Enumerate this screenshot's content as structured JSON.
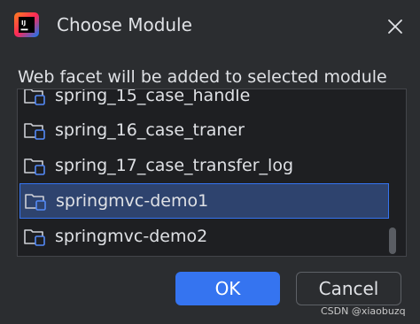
{
  "dialog": {
    "title": "Choose Module",
    "description": "Web facet will be added to selected module",
    "icons": {
      "app_logo": "intellij-idea-logo-icon",
      "close": "close-icon",
      "module": "module-folder-icon"
    },
    "colors": {
      "background": "#2b2d30",
      "list_background": "#1e1f22",
      "selection": "#2e436e",
      "accent": "#3574f0"
    }
  },
  "modules": [
    {
      "label": "spring_15_case_handle",
      "selected": false
    },
    {
      "label": "spring_16_case_traner",
      "selected": false
    },
    {
      "label": "spring_17_case_transfer_log",
      "selected": false
    },
    {
      "label": "springmvc-demo1",
      "selected": true
    },
    {
      "label": "springmvc-demo2",
      "selected": false
    }
  ],
  "buttons": {
    "ok": "OK",
    "cancel": "Cancel"
  },
  "watermark": "CSDN @xiaobuzq"
}
